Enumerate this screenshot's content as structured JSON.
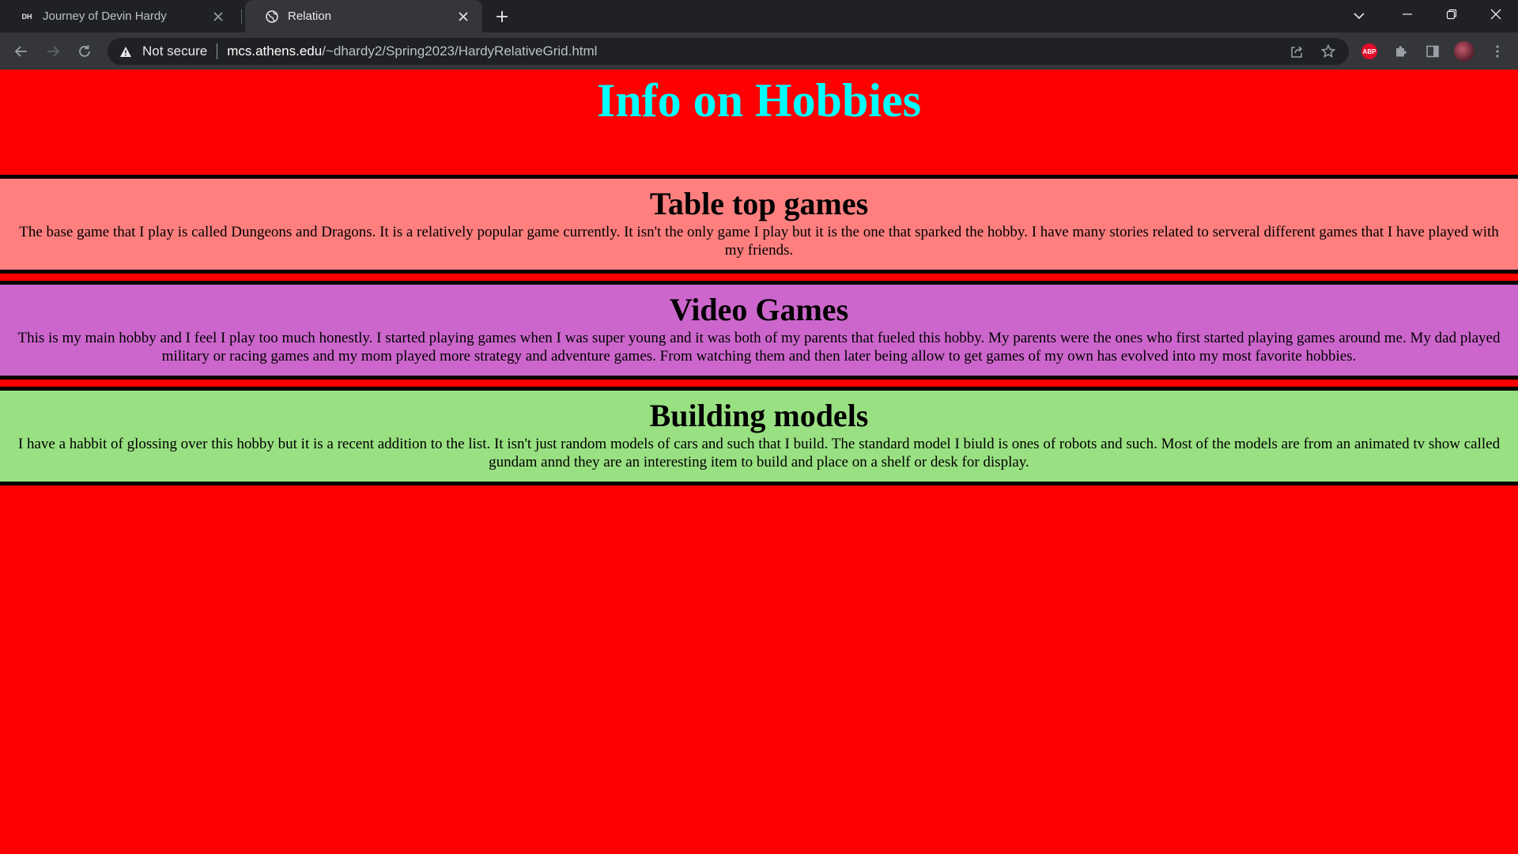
{
  "browser": {
    "tabs": [
      {
        "title": "Journey of Devin Hardy",
        "favicon": "DH",
        "active": false
      },
      {
        "title": "Relation",
        "favicon": "globe-icon",
        "active": true
      }
    ],
    "omnibox": {
      "security_label": "Not secure",
      "url_host": "mcs.athens.edu",
      "url_path": "/~dhardy2/Spring2023/HardyRelativeGrid.html"
    },
    "extensions": {
      "abp_label": "ABP"
    }
  },
  "page": {
    "title": "Info on Hobbies",
    "background": "#ff0000",
    "title_color": "#00ffff",
    "sections": [
      {
        "heading": "Table top games",
        "text": "The base game that I play is called Dungeons and Dragons. It is a relatively popular game currently. It isn't the only game I play but it is the one that sparked the hobby. I have many stories related to serveral different games that I have played with my friends.",
        "background": "#ff7f7f"
      },
      {
        "heading": "Video Games",
        "text": "This is my main hobby and I feel I play too much honestly. I started playing games when I was super young and it was both of my parents that fueled this hobby. My parents were the ones who first started playing games around me. My dad played military or racing games and my mom played more strategy and adventure games. From watching them and then later being allow to get games of my own has evolved into my most favorite hobbies.",
        "background": "#cc66cc"
      },
      {
        "heading": "Building models",
        "text": "I have a habbit of glossing over this hobby but it is a recent addition to the list. It isn't just random models of cars and such that I build. The standard model I biuld is ones of robots and such. Most of the models are from an animated tv show called gundam annd they are an interesting item to build and place on a shelf or desk for display.",
        "background": "#99e082"
      }
    ]
  }
}
